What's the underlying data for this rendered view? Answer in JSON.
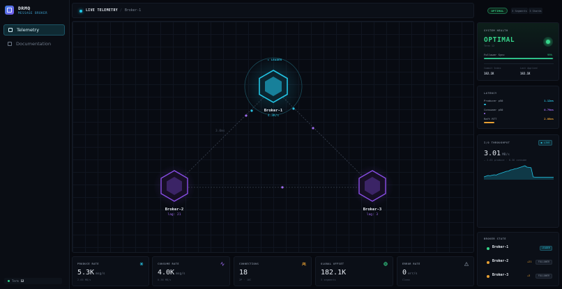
{
  "brand": {
    "title": "DRMQ",
    "subtitle": "MESSAGE BROKER"
  },
  "nav": [
    {
      "label": "Telemetry",
      "active": true
    },
    {
      "label": "Documentation",
      "active": false
    }
  ],
  "term": {
    "label": "Term",
    "value": "12"
  },
  "header": {
    "title": "LIVE TELEMETRY",
    "separator": "/",
    "crumb": "Broker-1",
    "status": "OPTIMAL",
    "chips": [
      "3 Segments",
      "3 Shards"
    ]
  },
  "topology": {
    "leader_tag": "★ LEADER",
    "link_label": "3.0ms",
    "brokers": [
      {
        "name": "Broker-1",
        "sub": "4.3K/s",
        "role": "leader"
      },
      {
        "name": "Broker-2",
        "sub": "lag: 21",
        "role": "follower"
      },
      {
        "name": "Broker-3",
        "sub": "lag: 3",
        "role": "follower"
      }
    ]
  },
  "metrics": [
    {
      "label": "PRODUCE RATE",
      "value": "5.3K",
      "unit": "msg/s",
      "sub": "2.65 MB/s",
      "icon": "activity-icon",
      "color": "#29c1e0"
    },
    {
      "label": "CONSUME RATE",
      "value": "4.0K",
      "unit": "msg/s",
      "sub": "0.36 MB/s",
      "icon": "pulse-icon",
      "color": "#a06cf0"
    },
    {
      "label": "CONNECTIONS",
      "value": "18",
      "unit": "",
      "sub": "2P · 16C",
      "icon": "users-icon",
      "color": "#e8a033"
    },
    {
      "label": "GLOBAL OFFSET",
      "value": "182.1K",
      "unit": "",
      "sub": "3 segments",
      "icon": "globe-icon",
      "color": "#36d68b"
    },
    {
      "label": "ERROR RATE",
      "value": "0",
      "unit": "err/s",
      "sub": "Clean",
      "icon": "warning-icon",
      "color": "#7d8796"
    }
  ],
  "health": {
    "title": "SYSTEM HEALTH",
    "status": "OPTIMAL",
    "term": "Term 12",
    "follower_sync_label": "Follower Sync",
    "follower_sync_value": "99%",
    "follower_sync_fraction": 0.99,
    "commit_label": "Commit Index",
    "commit_value": "182.1K",
    "applied_label": "Last Applied",
    "applied_value": "182.1K"
  },
  "latency": {
    "title": "LATENCY",
    "rows": [
      {
        "label": "Producer p50",
        "value": "1.12ms",
        "color": "#29c1e0",
        "fraction": 0.03
      },
      {
        "label": "Consumer p50",
        "value": "0.79ms",
        "color": "#a06cf0",
        "fraction": 0.02
      },
      {
        "label": "Raft RTT",
        "value": "2.08ms",
        "color": "#e8a033",
        "fraction": 0.15
      }
    ]
  },
  "throughput": {
    "title": "I/O THROUGHPUT",
    "live": "● LIVE",
    "value": "3.01",
    "unit": "MB/s",
    "legend": "— 2.65 produce · 0.36 consume",
    "chart_data": {
      "type": "area",
      "series": [
        {
          "values": [
            0.2,
            0.25,
            0.3,
            0.28,
            0.32,
            0.35,
            0.33,
            0.4,
            0.45,
            0.5,
            0.55,
            0.6,
            0.62,
            0.7,
            0.72,
            0.78,
            0.8,
            0.85,
            0.9,
            0.95,
            1.0,
            0.9,
            0.88,
            0.86,
            0.2,
            0.18,
            0.18,
            0.18,
            0.18,
            0.18,
            0.18,
            0.18,
            0.18,
            0.18,
            0.18
          ]
        }
      ]
    }
  },
  "broker_state": {
    "title": "BROKER STATE",
    "rows": [
      {
        "name": "Broker-1",
        "lag": "",
        "tag": "LEADER",
        "dot": "#36d68b",
        "tag_color": "#29c1e0",
        "tag_bg": "#0f2a33"
      },
      {
        "name": "Broker-2",
        "lag": "+21",
        "tag": "FOLLOWER",
        "dot": "#e8a033",
        "tag_color": "#7d8796",
        "tag_bg": "#161c27"
      },
      {
        "name": "Broker-3",
        "lag": "+3",
        "tag": "FOLLOWER",
        "dot": "#e8a033",
        "tag_color": "#7d8796",
        "tag_bg": "#161c27"
      }
    ]
  }
}
